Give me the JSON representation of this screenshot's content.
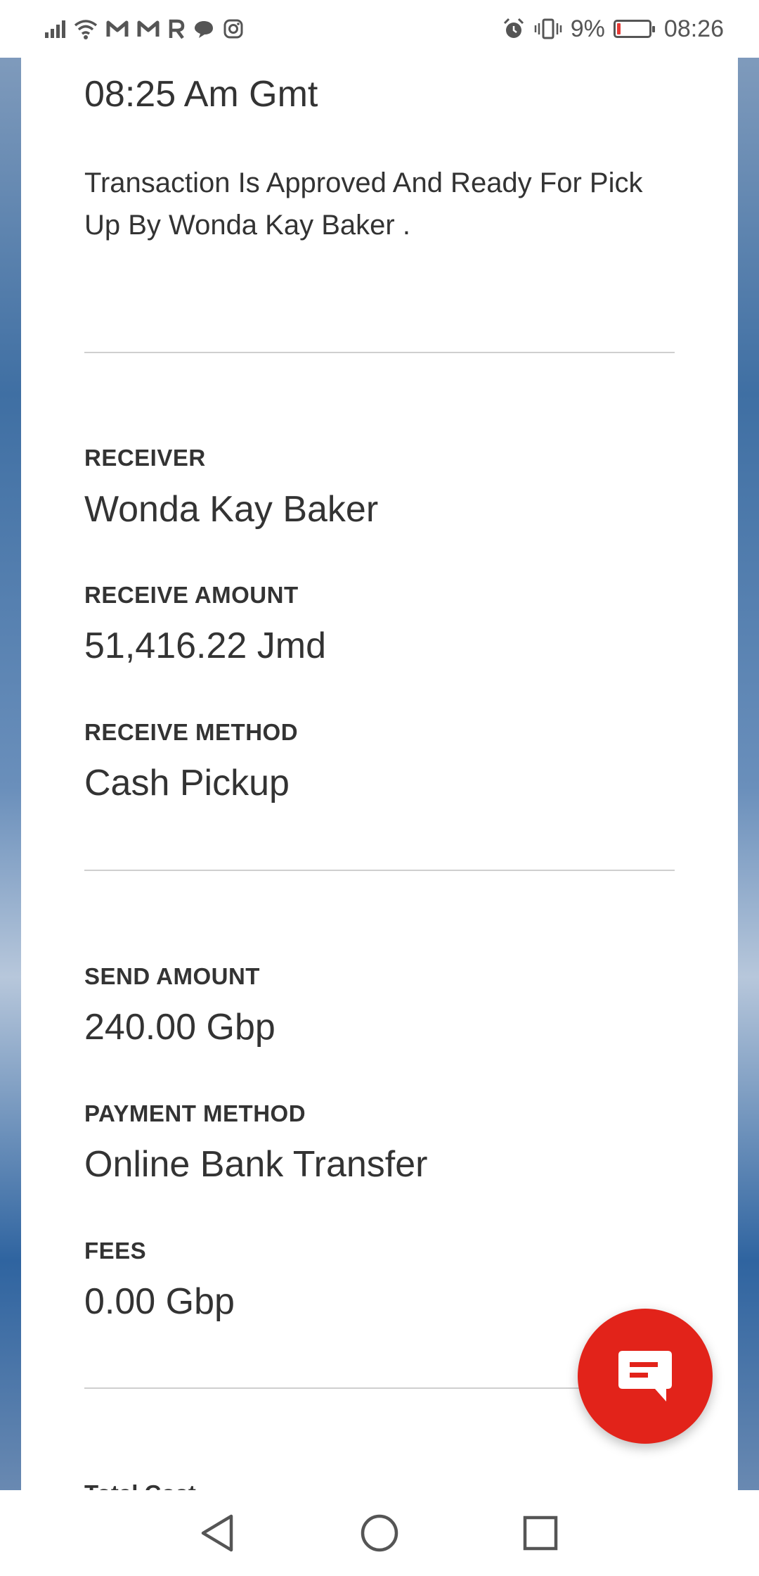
{
  "status_bar": {
    "notification_icons": [
      "signal-icon",
      "wifi-icon",
      "gmail-icon",
      "gmail-icon",
      "r-app-icon",
      "chat-icon",
      "instagram-icon"
    ],
    "alarm_icon": "alarm-icon",
    "vibrate_icon": "vibrate-icon",
    "battery_percent": "9%",
    "battery_level": 0.09,
    "time": "08:26"
  },
  "transaction": {
    "time": "08:25 Am Gmt",
    "message": "Transaction Is Approved And Ready For Pick Up By Wonda Kay Baker ."
  },
  "receiver_section": {
    "receiver_label": "RECEIVER",
    "receiver_value": "Wonda Kay Baker",
    "receive_amount_label": "RECEIVE AMOUNT",
    "receive_amount_value": "51,416.22 Jmd",
    "receive_method_label": "RECEIVE METHOD",
    "receive_method_value": "Cash Pickup"
  },
  "send_section": {
    "send_amount_label": "SEND AMOUNT",
    "send_amount_value": "240.00 Gbp",
    "payment_method_label": "PAYMENT METHOD",
    "payment_method_value": "Online Bank Transfer",
    "fees_label": "FEES",
    "fees_value": "0.00 Gbp"
  },
  "next_section": {
    "partial_label": "Total Cost"
  },
  "chat_button": {
    "icon": "chat-bubble-icon",
    "color": "#e2231a"
  },
  "nav_bar": {
    "back_icon": "back-triangle-icon",
    "home_icon": "home-circle-icon",
    "recents_icon": "recents-square-icon"
  }
}
